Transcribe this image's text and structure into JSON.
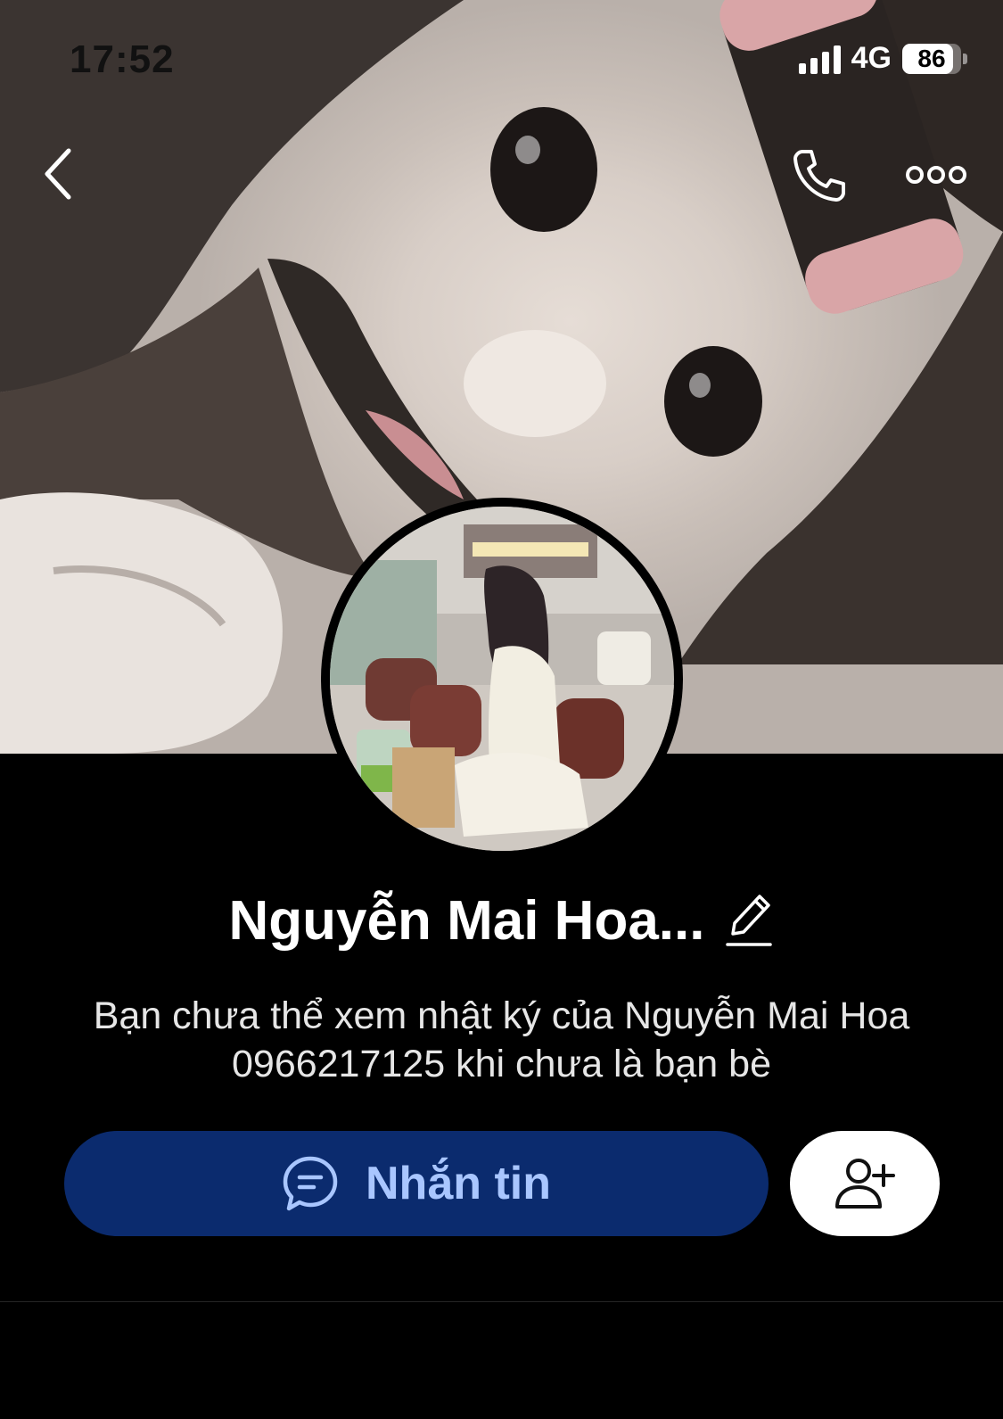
{
  "status_bar": {
    "time": "17:52",
    "network": "4G",
    "battery": "86",
    "battery_level": 0.86
  },
  "header": {
    "back_icon": "chevron-left-icon",
    "call_icon": "phone-icon",
    "more_icon": "more-dots-icon"
  },
  "profile": {
    "name": "Nguyễn Mai Hoa...",
    "edit_icon": "pencil-icon",
    "description": "Bạn chưa thể xem nhật ký của Nguyễn Mai Hoa 0966217125 khi chưa là bạn bè"
  },
  "actions": {
    "message_label": "Nhắn tin",
    "message_icon": "chat-bubble-icon",
    "add_friend_icon": "add-friend-icon"
  },
  "colors": {
    "background": "#000000",
    "message_button": "#0b2b6e",
    "message_text": "#a9c6ff",
    "add_button": "#ffffff"
  }
}
